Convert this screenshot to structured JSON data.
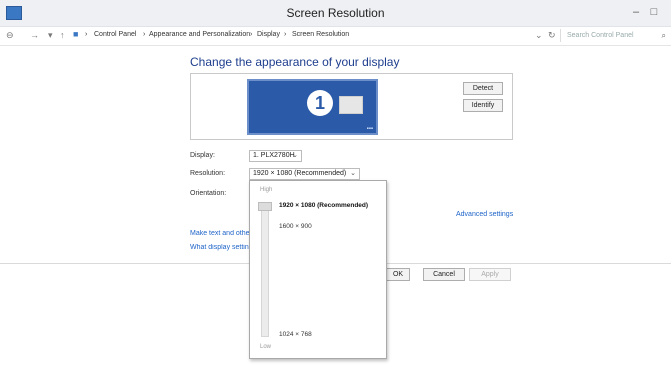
{
  "window": {
    "title": "Screen Resolution"
  },
  "address": {
    "crumbs": [
      "Control Panel",
      "Appearance and Personalization",
      "Display",
      "Screen Resolution"
    ],
    "separator": "›",
    "search_placeholder": "Search Control Panel"
  },
  "main": {
    "heading": "Change the appearance of your display",
    "monitor_number": "1",
    "detect_label": "Detect",
    "identify_label": "Identify",
    "display_label": "Display:",
    "display_value": "1. PLX2780H",
    "resolution_label": "Resolution:",
    "resolution_value": "1920 × 1080 (Recommended)",
    "orientation_label": "Orientation:",
    "advanced_link": "Advanced settings",
    "link1": "Make text and other",
    "link2": "What display settin",
    "ok_label": "OK",
    "cancel_label": "Cancel",
    "apply_label": "Apply"
  },
  "dropdown": {
    "high_label": "High",
    "low_label": "Low",
    "options": [
      "1920 × 1080 (Recommended)",
      "1600 × 900",
      "1024 × 768"
    ]
  }
}
